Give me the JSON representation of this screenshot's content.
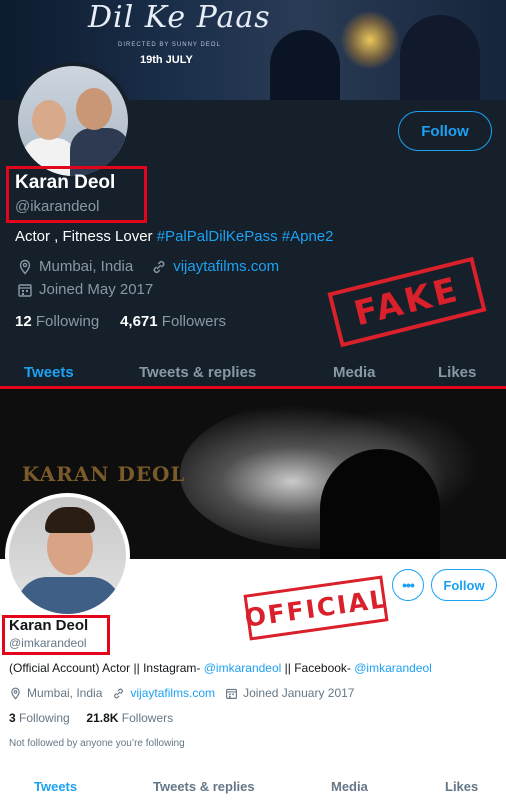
{
  "fake_profile": {
    "banner": {
      "poster_title": "Dil Ke Paas",
      "poster_credit": "DIRECTED BY SUNNY DEOL",
      "poster_date": "19th JULY"
    },
    "follow_label": "Follow",
    "name": "Karan Deol",
    "handle": "@ikarandeol",
    "bio_text": "Actor , Fitness Lover ",
    "bio_hashtags": "#PalPalDilKePass #Apne2",
    "location": "Mumbai, India",
    "website": "vijaytafilms.com",
    "joined": "Joined May 2017",
    "following_count": "12",
    "following_label": "Following",
    "followers_count": "4,671",
    "followers_label": "Followers",
    "tabs": [
      "Tweets",
      "Tweets & replies",
      "Media",
      "Likes"
    ],
    "stamp": "FAKE",
    "colors": {
      "background": "#15202b",
      "accent": "#1da1f2",
      "stamp": "#d9202b"
    }
  },
  "official_profile": {
    "banner": {
      "title": "KARAN DEOL"
    },
    "more_label": "•••",
    "follow_label": "Follow",
    "name": "Karan Deol",
    "handle": "@imkarandeol",
    "bio_prefix": "(Official Account) Actor || Instagram- ",
    "bio_instagram": "@imkarandeol",
    "bio_middle": " || Facebook- ",
    "bio_facebook": "@imkarandeol",
    "location": "Mumbai, India",
    "website": "vijaytafilms.com",
    "joined": "Joined January 2017",
    "following_count": "3",
    "following_label": "Following",
    "followers_count": "21.8K",
    "followers_label": "Followers",
    "not_followed": "Not followed by anyone you’re following",
    "tabs": [
      "Tweets",
      "Tweets & replies",
      "Media",
      "Likes"
    ],
    "stamp": "OFFICIAL",
    "colors": {
      "background": "#ffffff",
      "accent": "#1da1f2",
      "stamp": "#d9202b"
    }
  },
  "icons": {
    "location": "location-pin-icon",
    "link": "link-icon",
    "calendar": "calendar-icon"
  }
}
